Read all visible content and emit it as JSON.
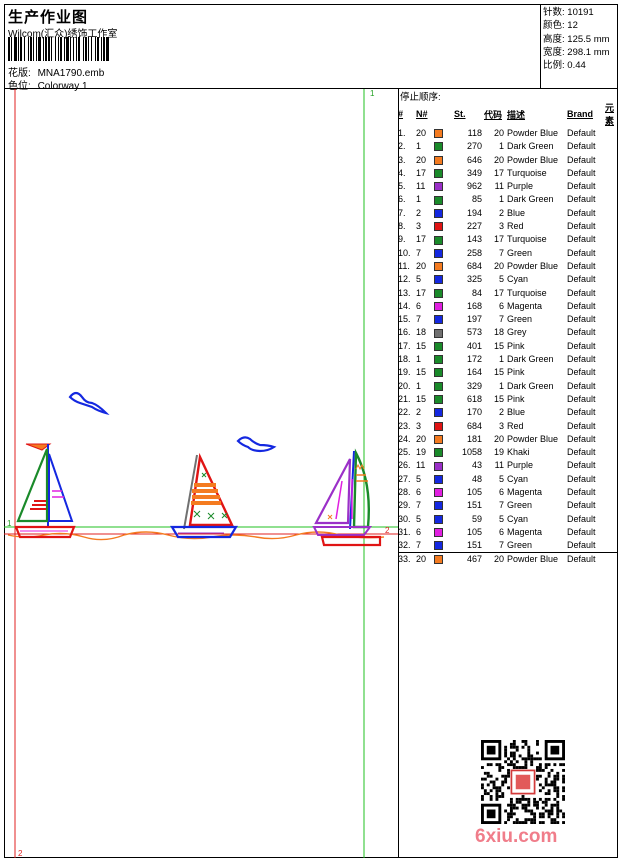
{
  "header": {
    "title": "生产作业图",
    "company": "Wilcom(汇众)绣饰工作室",
    "design_label": "花版:",
    "design_value": "MNA1790.emb",
    "color_label": "色位:",
    "color_value": "Colorway 1"
  },
  "stats": {
    "stitches_label": "针数:",
    "stitches_value": "10191",
    "colors_label": "颜色:",
    "colors_value": "12",
    "height_label": "高度:",
    "height_value": "125.5 mm",
    "width_label": "宽度:",
    "width_value": "298.1 mm",
    "scale_label": "比例:",
    "scale_value": "0.44"
  },
  "guides": {
    "v1": "1",
    "h1": "1",
    "h2": "2",
    "v2": "2"
  },
  "sequence": {
    "heading": "停止顺序:",
    "columns": [
      "#",
      "N#",
      "St.",
      "代码",
      "描述",
      "Brand",
      "元素"
    ],
    "rows": [
      {
        "i": "1.",
        "n": "20",
        "st": "118",
        "code": "20",
        "desc": "Powder Blue",
        "brand": "Default",
        "color": "#f47b20"
      },
      {
        "i": "2.",
        "n": "1",
        "st": "270",
        "code": "1",
        "desc": "Dark Green",
        "brand": "Default",
        "color": "#1a8a2a"
      },
      {
        "i": "3.",
        "n": "20",
        "st": "646",
        "code": "20",
        "desc": "Powder Blue",
        "brand": "Default",
        "color": "#f47b20"
      },
      {
        "i": "4.",
        "n": "17",
        "st": "349",
        "code": "17",
        "desc": "Turquoise",
        "brand": "Default",
        "color": "#1a8a2a"
      },
      {
        "i": "5.",
        "n": "11",
        "st": "962",
        "code": "11",
        "desc": "Purple",
        "brand": "Default",
        "color": "#9b30c8"
      },
      {
        "i": "6.",
        "n": "1",
        "st": "85",
        "code": "1",
        "desc": "Dark Green",
        "brand": "Default",
        "color": "#1a8a2a"
      },
      {
        "i": "7.",
        "n": "2",
        "st": "194",
        "code": "2",
        "desc": "Blue",
        "brand": "Default",
        "color": "#1428e0"
      },
      {
        "i": "8.",
        "n": "3",
        "st": "227",
        "code": "3",
        "desc": "Red",
        "brand": "Default",
        "color": "#e01414"
      },
      {
        "i": "9.",
        "n": "17",
        "st": "143",
        "code": "17",
        "desc": "Turquoise",
        "brand": "Default",
        "color": "#1a8a2a"
      },
      {
        "i": "10.",
        "n": "7",
        "st": "258",
        "code": "7",
        "desc": "Green",
        "brand": "Default",
        "color": "#1428e0"
      },
      {
        "i": "11.",
        "n": "20",
        "st": "684",
        "code": "20",
        "desc": "Powder Blue",
        "brand": "Default",
        "color": "#f47b20"
      },
      {
        "i": "12.",
        "n": "5",
        "st": "325",
        "code": "5",
        "desc": "Cyan",
        "brand": "Default",
        "color": "#1428e0"
      },
      {
        "i": "13.",
        "n": "17",
        "st": "84",
        "code": "17",
        "desc": "Turquoise",
        "brand": "Default",
        "color": "#1a8a2a"
      },
      {
        "i": "14.",
        "n": "6",
        "st": "168",
        "code": "6",
        "desc": "Magenta",
        "brand": "Default",
        "color": "#e020e0"
      },
      {
        "i": "15.",
        "n": "7",
        "st": "197",
        "code": "7",
        "desc": "Green",
        "brand": "Default",
        "color": "#1428e0"
      },
      {
        "i": "16.",
        "n": "18",
        "st": "573",
        "code": "18",
        "desc": "Grey",
        "brand": "Default",
        "color": "#707070"
      },
      {
        "i": "17.",
        "n": "15",
        "st": "401",
        "code": "15",
        "desc": "Pink",
        "brand": "Default",
        "color": "#1a8a2a"
      },
      {
        "i": "18.",
        "n": "1",
        "st": "172",
        "code": "1",
        "desc": "Dark Green",
        "brand": "Default",
        "color": "#1a8a2a"
      },
      {
        "i": "19.",
        "n": "15",
        "st": "164",
        "code": "15",
        "desc": "Pink",
        "brand": "Default",
        "color": "#1a8a2a"
      },
      {
        "i": "20.",
        "n": "1",
        "st": "329",
        "code": "1",
        "desc": "Dark Green",
        "brand": "Default",
        "color": "#1a8a2a"
      },
      {
        "i": "21.",
        "n": "15",
        "st": "618",
        "code": "15",
        "desc": "Pink",
        "brand": "Default",
        "color": "#1a8a2a"
      },
      {
        "i": "22.",
        "n": "2",
        "st": "170",
        "code": "2",
        "desc": "Blue",
        "brand": "Default",
        "color": "#1428e0"
      },
      {
        "i": "23.",
        "n": "3",
        "st": "684",
        "code": "3",
        "desc": "Red",
        "brand": "Default",
        "color": "#e01414"
      },
      {
        "i": "24.",
        "n": "20",
        "st": "181",
        "code": "20",
        "desc": "Powder Blue",
        "brand": "Default",
        "color": "#f47b20"
      },
      {
        "i": "25.",
        "n": "19",
        "st": "1058",
        "code": "19",
        "desc": "Khaki",
        "brand": "Default",
        "color": "#1a8a2a"
      },
      {
        "i": "26.",
        "n": "11",
        "st": "43",
        "code": "11",
        "desc": "Purple",
        "brand": "Default",
        "color": "#9b30c8"
      },
      {
        "i": "27.",
        "n": "5",
        "st": "48",
        "code": "5",
        "desc": "Cyan",
        "brand": "Default",
        "color": "#1428e0"
      },
      {
        "i": "28.",
        "n": "6",
        "st": "105",
        "code": "6",
        "desc": "Magenta",
        "brand": "Default",
        "color": "#e020e0"
      },
      {
        "i": "29.",
        "n": "7",
        "st": "151",
        "code": "7",
        "desc": "Green",
        "brand": "Default",
        "color": "#1428e0"
      },
      {
        "i": "30.",
        "n": "5",
        "st": "59",
        "code": "5",
        "desc": "Cyan",
        "brand": "Default",
        "color": "#1428e0"
      },
      {
        "i": "31.",
        "n": "6",
        "st": "105",
        "code": "6",
        "desc": "Magenta",
        "brand": "Default",
        "color": "#e020e0"
      },
      {
        "i": "32.",
        "n": "7",
        "st": "151",
        "code": "7",
        "desc": "Green",
        "brand": "Default",
        "color": "#1428e0"
      },
      {
        "i": "33.",
        "n": "20",
        "st": "467",
        "code": "20",
        "desc": "Powder Blue",
        "brand": "Default",
        "color": "#f47b20"
      }
    ]
  },
  "watermark": "6xiu.com"
}
